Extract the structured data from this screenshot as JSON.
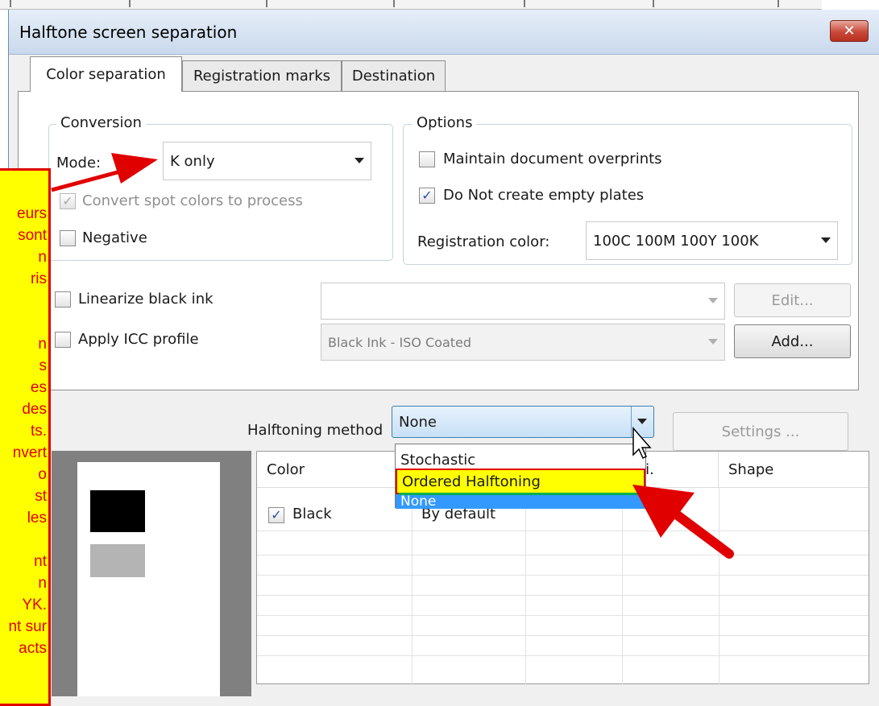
{
  "window": {
    "title": "Halftone screen separation",
    "close_glyph": "✕"
  },
  "tabs": [
    {
      "label": "Color separation",
      "active": true
    },
    {
      "label": "Registration marks",
      "active": false
    },
    {
      "label": "Destination",
      "active": false
    }
  ],
  "conversion": {
    "legend": "Conversion",
    "mode_label": "Mode:",
    "mode_value": "K only",
    "convert_spot": {
      "label": "Convert spot colors to process",
      "checked": true,
      "enabled": false
    },
    "negative": {
      "label": "Negative",
      "checked": false
    }
  },
  "options": {
    "legend": "Options",
    "maintain_overprints": {
      "label": "Maintain document overprints",
      "checked": false
    },
    "no_empty_plates": {
      "label": "Do Not create empty plates",
      "checked": true
    },
    "registration_label": "Registration color:",
    "registration_value": "100C 100M 100Y 100K"
  },
  "linearize": {
    "label": "Linearize black ink",
    "checked": false,
    "combo_value": "",
    "edit_label": "Edit..."
  },
  "icc": {
    "label": "Apply ICC profile",
    "checked": false,
    "combo_value": "Black Ink - ISO Coated",
    "add_label": "Add..."
  },
  "halftoning": {
    "label": "Halftoning method",
    "value": "None",
    "settings_label": "Settings ...",
    "options": [
      "Stochastic",
      "Ordered Halftoning",
      "None"
    ],
    "highlighted": "Ordered Halftoning",
    "selected": "None"
  },
  "preview": {
    "swatches": [
      "#000000",
      "#b4b4b4"
    ]
  },
  "table": {
    "headers": [
      "Color",
      "",
      "",
      "p.i.",
      "Shape"
    ],
    "rows": [
      {
        "color": "Black",
        "checked": true,
        "method": "By default"
      }
    ]
  },
  "note": {
    "text_lines": [
      "eurs",
      "sont",
      "n",
      "ris",
      "",
      "",
      "n",
      "s",
      "es",
      "des",
      "ts.",
      "nvert",
      "o",
      "st",
      "les",
      "",
      "nt",
      "n",
      "YK.",
      "nt sur",
      "acts"
    ]
  },
  "colors": {
    "accent": "#3c7fb1",
    "annotation_red": "#e00000",
    "annotation_yellow": "#ffff00",
    "highlight_green": "#00b050"
  },
  "icons": {
    "close": "close-icon",
    "dropdown": "chevron-down-icon",
    "check": "checkmark-icon",
    "cursor": "mouse-pointer-icon",
    "arrow": "red-arrow-icon"
  }
}
